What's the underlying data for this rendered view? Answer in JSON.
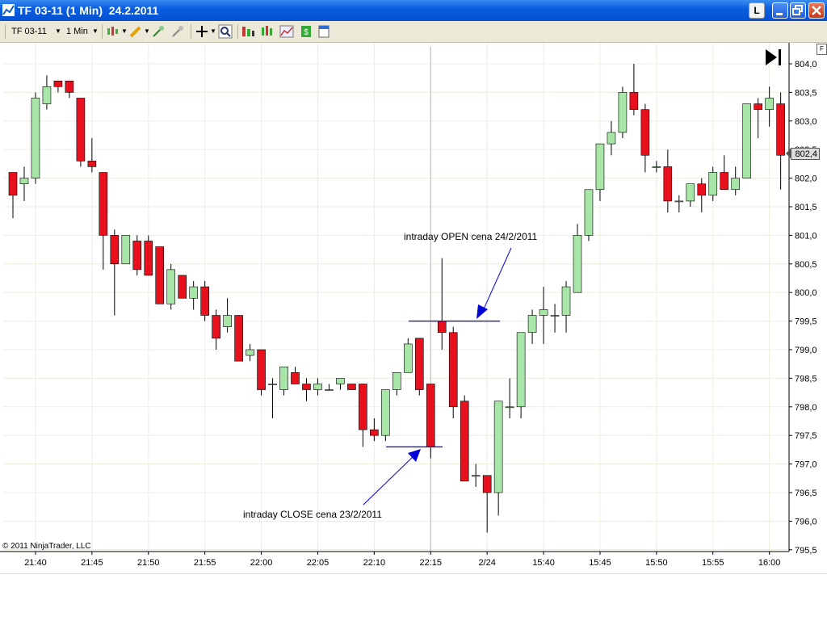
{
  "window": {
    "title": "TF 03-11 (1 Min)  24.2.2011",
    "l_button": "L"
  },
  "toolbar": {
    "instrument": "TF 03-11",
    "interval": "1 Min"
  },
  "chart": {
    "price_axis_labels": [
      "804,0",
      "803,5",
      "803,0",
      "802,5",
      "802,0",
      "801,5",
      "801,0",
      "800,5",
      "800,0",
      "799,5",
      "799,0",
      "798,5",
      "798,0",
      "797,5",
      "797,0",
      "796,5",
      "796,0",
      "795,5"
    ],
    "time_axis_labels": [
      "21:40",
      "21:45",
      "21:50",
      "21:55",
      "22:00",
      "22:05",
      "22:10",
      "22:15",
      "2/24",
      "15:40",
      "15:45",
      "15:50",
      "15:55",
      "16:00"
    ],
    "last_price": "802,4",
    "copyright": "© 2011 NinjaTrader, LLC",
    "annotation_open": "intraday OPEN cena 24/2/2011",
    "annotation_close": "intraday CLOSE cena 23/2/2011",
    "f_button": "F",
    "colors": {
      "up": "#a8e6a8",
      "down": "#e8101c",
      "annotation": "#0000d8"
    }
  },
  "chart_data": {
    "type": "candlestick",
    "candles": [
      {
        "o": 802.1,
        "h": 802.1,
        "l": 801.3,
        "c": 801.7
      },
      {
        "o": 801.9,
        "h": 802.2,
        "l": 801.6,
        "c": 802.0
      },
      {
        "o": 802.0,
        "h": 803.5,
        "l": 801.9,
        "c": 803.4
      },
      {
        "o": 803.3,
        "h": 803.8,
        "l": 803.2,
        "c": 803.6
      },
      {
        "o": 803.7,
        "h": 803.7,
        "l": 803.5,
        "c": 803.6
      },
      {
        "o": 803.7,
        "h": 803.7,
        "l": 803.4,
        "c": 803.5
      },
      {
        "o": 803.4,
        "h": 803.4,
        "l": 802.2,
        "c": 802.3
      },
      {
        "o": 802.3,
        "h": 802.7,
        "l": 802.1,
        "c": 802.2
      },
      {
        "o": 802.1,
        "h": 802.1,
        "l": 800.4,
        "c": 801.0
      },
      {
        "o": 801.0,
        "h": 801.1,
        "l": 799.6,
        "c": 800.5
      },
      {
        "o": 800.5,
        "h": 801.0,
        "l": 800.5,
        "c": 801.0
      },
      {
        "o": 800.9,
        "h": 801.0,
        "l": 800.3,
        "c": 800.4
      },
      {
        "o": 800.9,
        "h": 801.0,
        "l": 800.3,
        "c": 800.3
      },
      {
        "o": 800.8,
        "h": 800.8,
        "l": 799.8,
        "c": 799.8
      },
      {
        "o": 799.8,
        "h": 800.5,
        "l": 799.7,
        "c": 800.4
      },
      {
        "o": 800.3,
        "h": 800.3,
        "l": 799.9,
        "c": 799.9
      },
      {
        "o": 799.9,
        "h": 800.2,
        "l": 799.7,
        "c": 800.1
      },
      {
        "o": 800.1,
        "h": 800.2,
        "l": 799.5,
        "c": 799.6
      },
      {
        "o": 799.6,
        "h": 799.7,
        "l": 799.0,
        "c": 799.2
      },
      {
        "o": 799.4,
        "h": 799.9,
        "l": 799.3,
        "c": 799.6
      },
      {
        "o": 799.6,
        "h": 799.6,
        "l": 798.8,
        "c": 798.8
      },
      {
        "o": 798.9,
        "h": 799.1,
        "l": 798.8,
        "c": 799.0
      },
      {
        "o": 799.0,
        "h": 799.0,
        "l": 798.2,
        "c": 798.3
      },
      {
        "o": 798.4,
        "h": 798.5,
        "l": 797.8,
        "c": 798.4
      },
      {
        "o": 798.3,
        "h": 798.7,
        "l": 798.2,
        "c": 798.7
      },
      {
        "o": 798.6,
        "h": 798.7,
        "l": 798.4,
        "c": 798.4
      },
      {
        "o": 798.4,
        "h": 798.5,
        "l": 798.1,
        "c": 798.3
      },
      {
        "o": 798.3,
        "h": 798.5,
        "l": 798.2,
        "c": 798.4
      },
      {
        "o": 798.3,
        "h": 798.4,
        "l": 798.3,
        "c": 798.3
      },
      {
        "o": 798.4,
        "h": 798.5,
        "l": 798.3,
        "c": 798.5
      },
      {
        "o": 798.4,
        "h": 798.4,
        "l": 798.3,
        "c": 798.3
      },
      {
        "o": 798.4,
        "h": 798.4,
        "l": 797.3,
        "c": 797.6
      },
      {
        "o": 797.6,
        "h": 797.8,
        "l": 797.4,
        "c": 797.5
      },
      {
        "o": 797.5,
        "h": 798.3,
        "l": 797.4,
        "c": 798.3
      },
      {
        "o": 798.3,
        "h": 798.6,
        "l": 798.2,
        "c": 798.6
      },
      {
        "o": 798.6,
        "h": 799.2,
        "l": 798.6,
        "c": 799.1
      },
      {
        "o": 799.2,
        "h": 799.2,
        "l": 798.2,
        "c": 798.3
      },
      {
        "o": 798.4,
        "h": 798.4,
        "l": 797.1,
        "c": 797.3
      },
      {
        "o": 799.5,
        "h": 800.6,
        "l": 799.0,
        "c": 799.3
      },
      {
        "o": 799.3,
        "h": 799.4,
        "l": 797.8,
        "c": 798.0
      },
      {
        "o": 798.1,
        "h": 798.2,
        "l": 796.7,
        "c": 796.7
      },
      {
        "o": 796.8,
        "h": 797.0,
        "l": 796.6,
        "c": 796.8
      },
      {
        "o": 796.8,
        "h": 796.8,
        "l": 795.8,
        "c": 796.5
      },
      {
        "o": 796.5,
        "h": 798.1,
        "l": 796.1,
        "c": 798.1
      },
      {
        "o": 798.0,
        "h": 798.5,
        "l": 797.8,
        "c": 798.0
      },
      {
        "o": 798.0,
        "h": 799.3,
        "l": 797.8,
        "c": 799.3
      },
      {
        "o": 799.3,
        "h": 799.7,
        "l": 799.1,
        "c": 799.6
      },
      {
        "o": 799.6,
        "h": 800.1,
        "l": 799.1,
        "c": 799.7
      },
      {
        "o": 799.6,
        "h": 799.8,
        "l": 799.3,
        "c": 799.6
      },
      {
        "o": 799.6,
        "h": 800.2,
        "l": 799.3,
        "c": 800.1
      },
      {
        "o": 800.0,
        "h": 801.2,
        "l": 800.0,
        "c": 801.0
      },
      {
        "o": 801.0,
        "h": 801.8,
        "l": 800.9,
        "c": 801.8
      },
      {
        "o": 801.8,
        "h": 802.6,
        "l": 801.6,
        "c": 802.6
      },
      {
        "o": 802.6,
        "h": 803.0,
        "l": 802.4,
        "c": 802.8
      },
      {
        "o": 802.8,
        "h": 803.6,
        "l": 802.7,
        "c": 803.5
      },
      {
        "o": 803.5,
        "h": 804.0,
        "l": 803.1,
        "c": 803.2
      },
      {
        "o": 803.2,
        "h": 803.3,
        "l": 802.1,
        "c": 802.4
      },
      {
        "o": 802.2,
        "h": 802.3,
        "l": 802.1,
        "c": 802.2
      },
      {
        "o": 802.2,
        "h": 802.5,
        "l": 801.4,
        "c": 801.6
      },
      {
        "o": 801.6,
        "h": 801.7,
        "l": 801.4,
        "c": 801.6
      },
      {
        "o": 801.6,
        "h": 801.9,
        "l": 801.5,
        "c": 801.9
      },
      {
        "o": 801.9,
        "h": 802.0,
        "l": 801.4,
        "c": 801.7
      },
      {
        "o": 801.7,
        "h": 802.2,
        "l": 801.6,
        "c": 802.1
      },
      {
        "o": 802.1,
        "h": 802.4,
        "l": 801.8,
        "c": 801.8
      },
      {
        "o": 801.8,
        "h": 802.2,
        "l": 801.7,
        "c": 802.0
      },
      {
        "o": 802.0,
        "h": 803.3,
        "l": 802.0,
        "c": 803.3
      },
      {
        "o": 803.3,
        "h": 803.4,
        "l": 802.7,
        "c": 803.2
      },
      {
        "o": 803.2,
        "h": 803.6,
        "l": 802.9,
        "c": 803.4
      },
      {
        "o": 803.3,
        "h": 803.5,
        "l": 801.8,
        "c": 802.4
      }
    ],
    "annotation_lines": [
      {
        "price": 799.5,
        "label": "intraday OPEN cena 24/2/2011"
      },
      {
        "price": 797.3,
        "label": "intraday CLOSE cena 23/2/2011"
      }
    ],
    "session_break_after_index": 37,
    "ylim": [
      795.5,
      804.2
    ],
    "xlabel": "",
    "ylabel": ""
  }
}
